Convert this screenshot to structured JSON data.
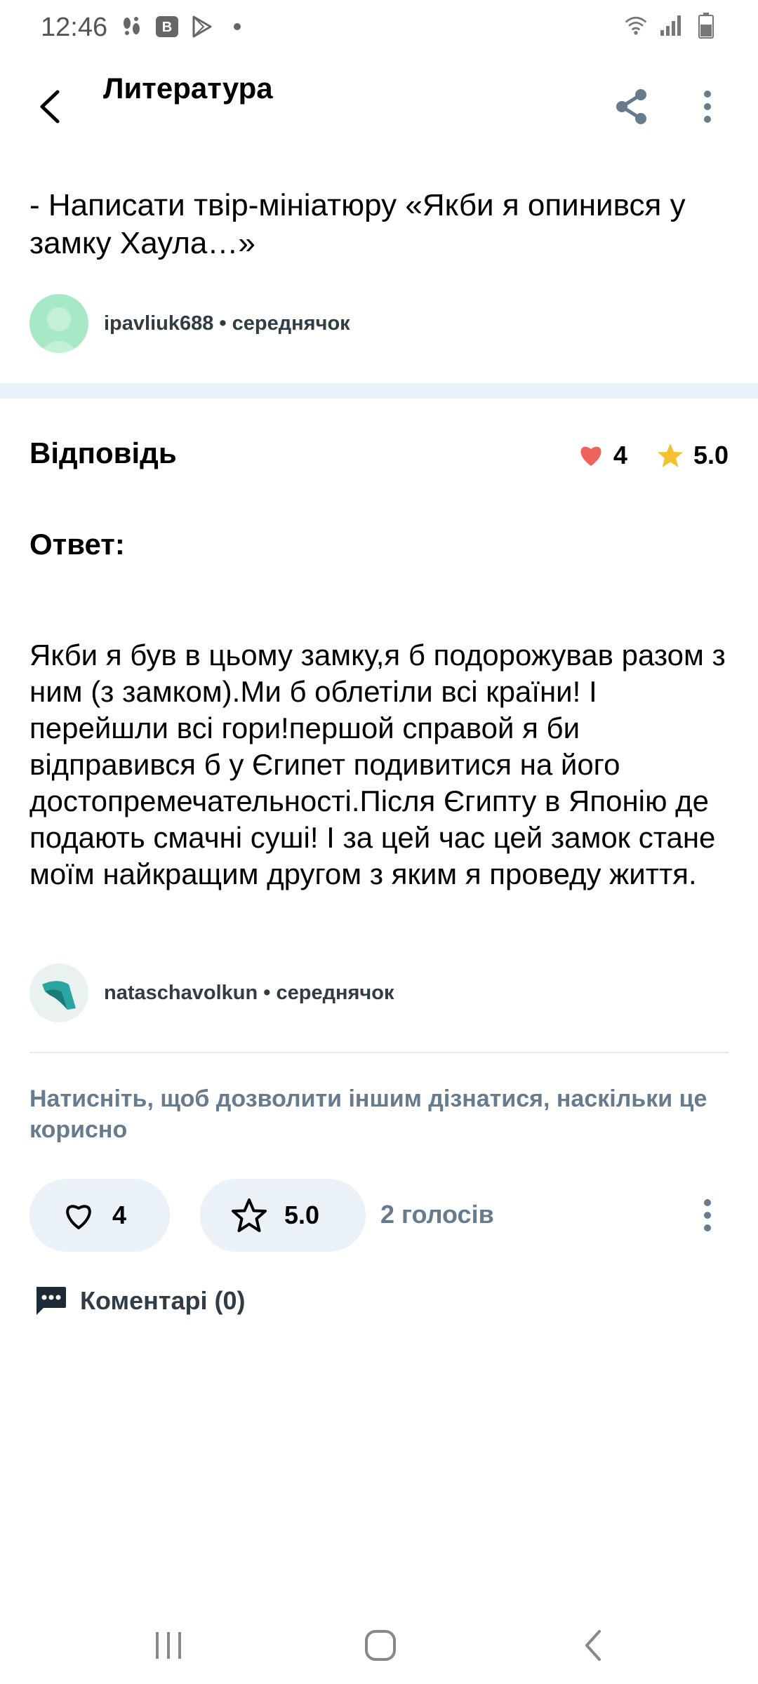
{
  "status_bar": {
    "time": "12:46",
    "left_icons": [
      "steps-icon",
      "vk-icon",
      "play-store-icon",
      "dot-icon"
    ],
    "right_icons": [
      "wifi-icon",
      "signal-icon",
      "battery-icon"
    ]
  },
  "appbar": {
    "title": "Литература",
    "back_icon": "arrow-back-icon",
    "share_icon": "share-icon",
    "more_icon": "more-vertical-icon"
  },
  "question": {
    "text": "- Написати твір-мініатюру «Якби я опинився у замку Хаула…»",
    "author": "ipavliuk688",
    "separator": " • ",
    "rank": "середнячок"
  },
  "answer": {
    "title": "Відповідь",
    "likes": "4",
    "rating": "5.0",
    "label": "Ответ:",
    "body": "Якби я був в цьому замку,я б подорожував разом з ним (з замком).Ми б облетіли всі країни! І перейшли всі гори!першой справой я би відправився б у Єгипет подивитися на його достопремечательності.Після Єгипту в Японію де подають смачні суші! І за цей час цей замок стане моїм найкращим другом з яким я проведу життя.",
    "author": "nataschavolkun",
    "separator": " • ",
    "rank": "середнячок"
  },
  "rating_section": {
    "hint": "Натисніть, щоб дозволити іншим дізнатися, наскільки це корисно",
    "like_count": "4",
    "rating_value": "5.0",
    "votes": "2 голосів"
  },
  "comments": {
    "label": "Коментарі (0)"
  },
  "colors": {
    "heart": "#f0635a",
    "star": "#f5c12e",
    "muted_text": "#687b8c",
    "pill_bg": "#ebf2f7",
    "band": "#e9f1fb",
    "avatar_question": "#a7e8c6"
  },
  "navbar": {
    "icons": [
      "recent-apps-icon",
      "home-icon",
      "nav-back-icon"
    ]
  }
}
